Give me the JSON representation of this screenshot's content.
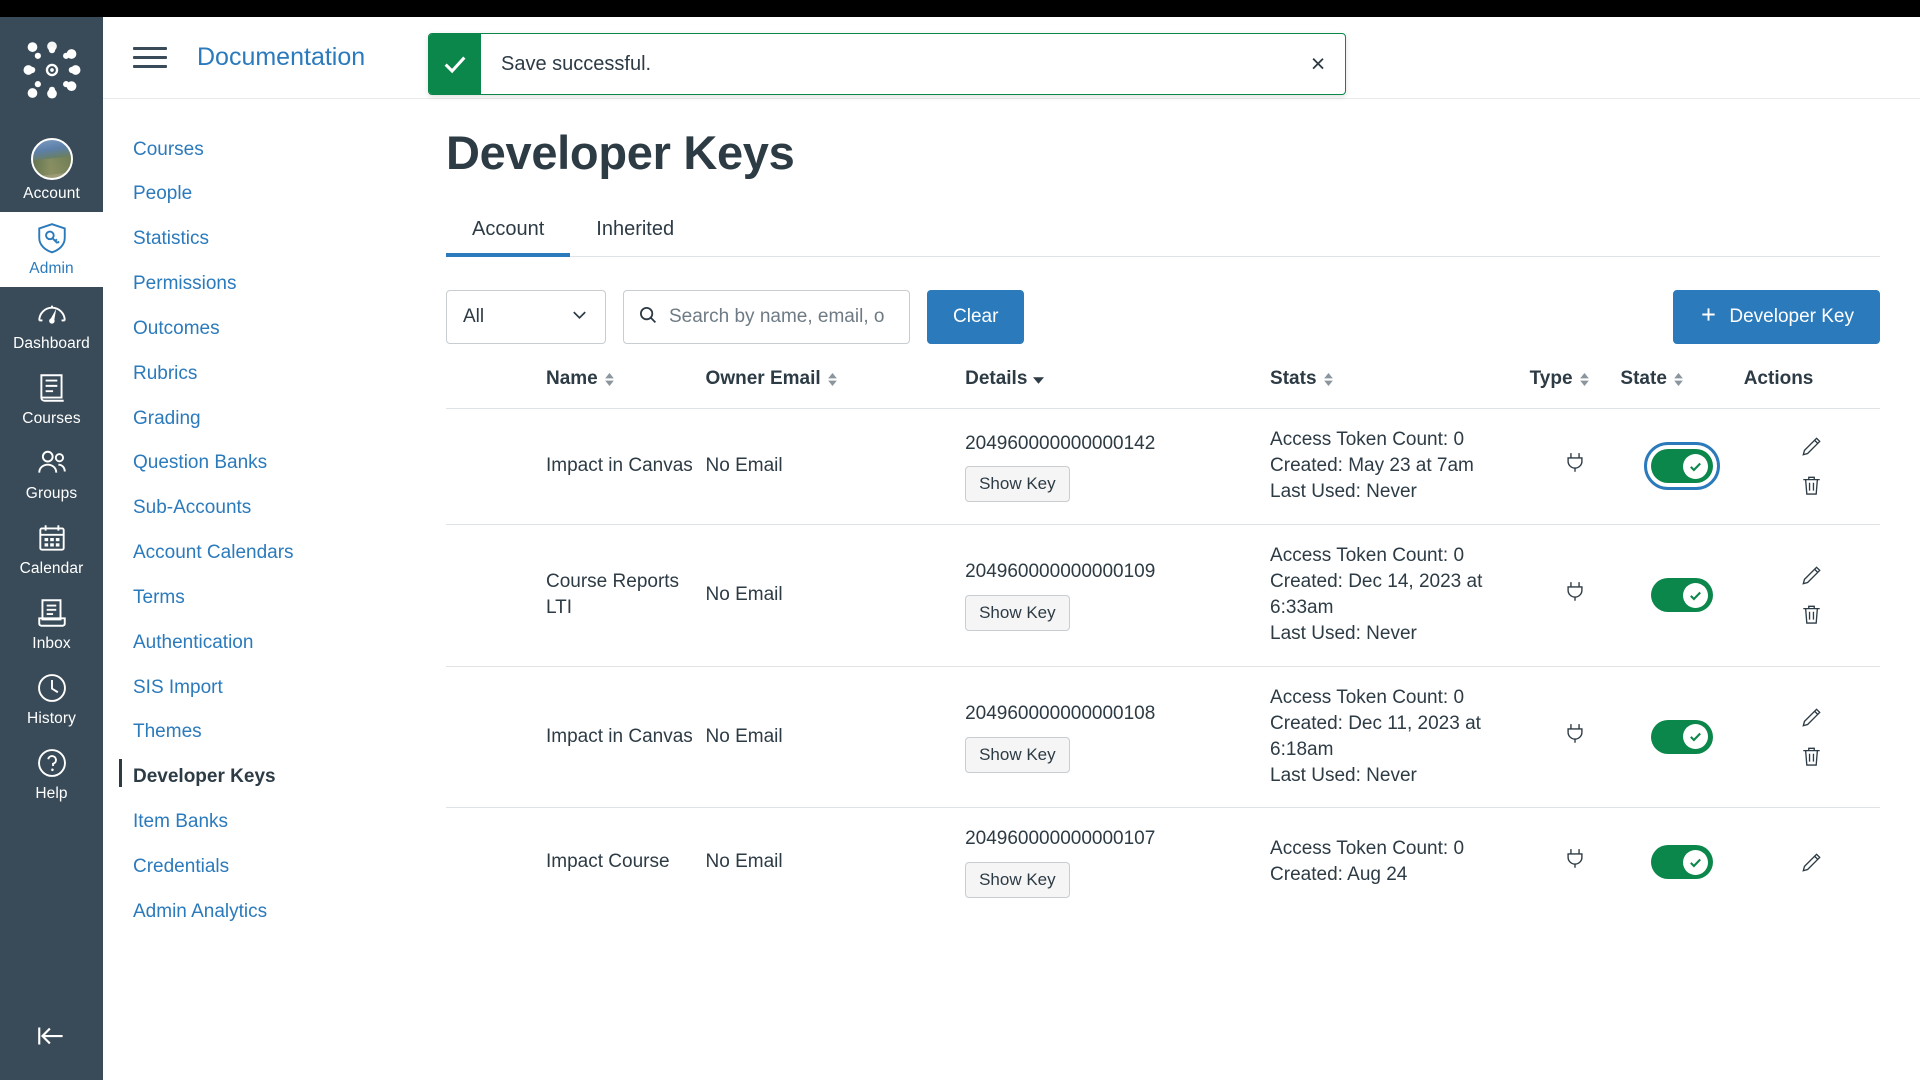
{
  "global_nav": {
    "logo": "canvas-logo",
    "items": [
      {
        "label": "Account",
        "icon": "avatar",
        "active": false
      },
      {
        "label": "Admin",
        "icon": "shield-key-icon",
        "active": true
      },
      {
        "label": "Dashboard",
        "icon": "speedometer-icon",
        "active": false
      },
      {
        "label": "Courses",
        "icon": "book-icon",
        "active": false
      },
      {
        "label": "Groups",
        "icon": "people-icon",
        "active": false
      },
      {
        "label": "Calendar",
        "icon": "calendar-icon",
        "active": false
      },
      {
        "label": "Inbox",
        "icon": "inbox-icon",
        "active": false
      },
      {
        "label": "History",
        "icon": "clock-icon",
        "active": false
      },
      {
        "label": "Help",
        "icon": "question-circle-icon",
        "active": false
      }
    ],
    "collapse_icon": "arrow-left-bar-icon"
  },
  "header": {
    "menu_icon": "hamburger-icon",
    "breadcrumb": "Documentation"
  },
  "alert": {
    "icon": "check-icon",
    "message": "Save successful.",
    "close_label": "×",
    "accent_color": "#0B874B"
  },
  "context_nav": {
    "items": [
      {
        "label": "Courses",
        "active": false
      },
      {
        "label": "People",
        "active": false
      },
      {
        "label": "Statistics",
        "active": false
      },
      {
        "label": "Permissions",
        "active": false
      },
      {
        "label": "Outcomes",
        "active": false
      },
      {
        "label": "Rubrics",
        "active": false
      },
      {
        "label": "Grading",
        "active": false
      },
      {
        "label": "Question Banks",
        "active": false
      },
      {
        "label": "Sub-Accounts",
        "active": false
      },
      {
        "label": "Account Calendars",
        "active": false
      },
      {
        "label": "Terms",
        "active": false
      },
      {
        "label": "Authentication",
        "active": false
      },
      {
        "label": "SIS Import",
        "active": false
      },
      {
        "label": "Themes",
        "active": false
      },
      {
        "label": "Developer Keys",
        "active": true
      },
      {
        "label": "Item Banks",
        "active": false
      },
      {
        "label": "Credentials",
        "active": false
      },
      {
        "label": "Admin Analytics",
        "active": false
      }
    ]
  },
  "main": {
    "page_title": "Developer Keys",
    "tabs": [
      {
        "label": "Account",
        "active": true
      },
      {
        "label": "Inherited",
        "active": false
      }
    ],
    "toolbar": {
      "filter_value": "All",
      "filter_icon": "chevron-down-icon",
      "search_icon": "search-icon",
      "search_value": "",
      "search_placeholder": "Search by name, email, o",
      "clear_label": "Clear",
      "add_key_label": "Developer Key",
      "add_key_icon": "plus-icon",
      "accent_color": "#2B7ABC"
    },
    "table": {
      "columns": [
        {
          "label": "Name",
          "sort": "none"
        },
        {
          "label": "Owner Email",
          "sort": "none"
        },
        {
          "label": "Details",
          "sort": "desc"
        },
        {
          "label": "Stats",
          "sort": "none"
        },
        {
          "label": "Type",
          "sort": "none"
        },
        {
          "label": "State",
          "sort": "none"
        },
        {
          "label": "Actions",
          "sort": null
        }
      ],
      "show_key_label": "Show Key",
      "type_icon": "plug-icon",
      "edit_icon": "pencil-icon",
      "delete_icon": "trash-icon",
      "rows": [
        {
          "name": "Impact in Canvas",
          "owner_email": "No Email",
          "key_id": "204960000000000142",
          "stats": "Access Token Count: 0\nCreated: May 23 at 7am\nLast Used: Never",
          "state_on": true,
          "state_focused": true
        },
        {
          "name": "Course Reports LTI",
          "owner_email": "No Email",
          "key_id": "204960000000000109",
          "stats": "Access Token Count: 0\nCreated: Dec 14, 2023 at 6:33am\nLast Used: Never",
          "state_on": true,
          "state_focused": false
        },
        {
          "name": "Impact in Canvas",
          "owner_email": "No Email",
          "key_id": "204960000000000108",
          "stats": "Access Token Count: 0\nCreated: Dec 11, 2023 at 6:18am\nLast Used: Never",
          "state_on": true,
          "state_focused": false
        },
        {
          "name": "Impact Course",
          "owner_email": "No Email",
          "key_id": "204960000000000107",
          "stats": "Access Token Count: 0\nCreated: Aug 24",
          "state_on": true,
          "state_focused": false
        }
      ]
    }
  }
}
